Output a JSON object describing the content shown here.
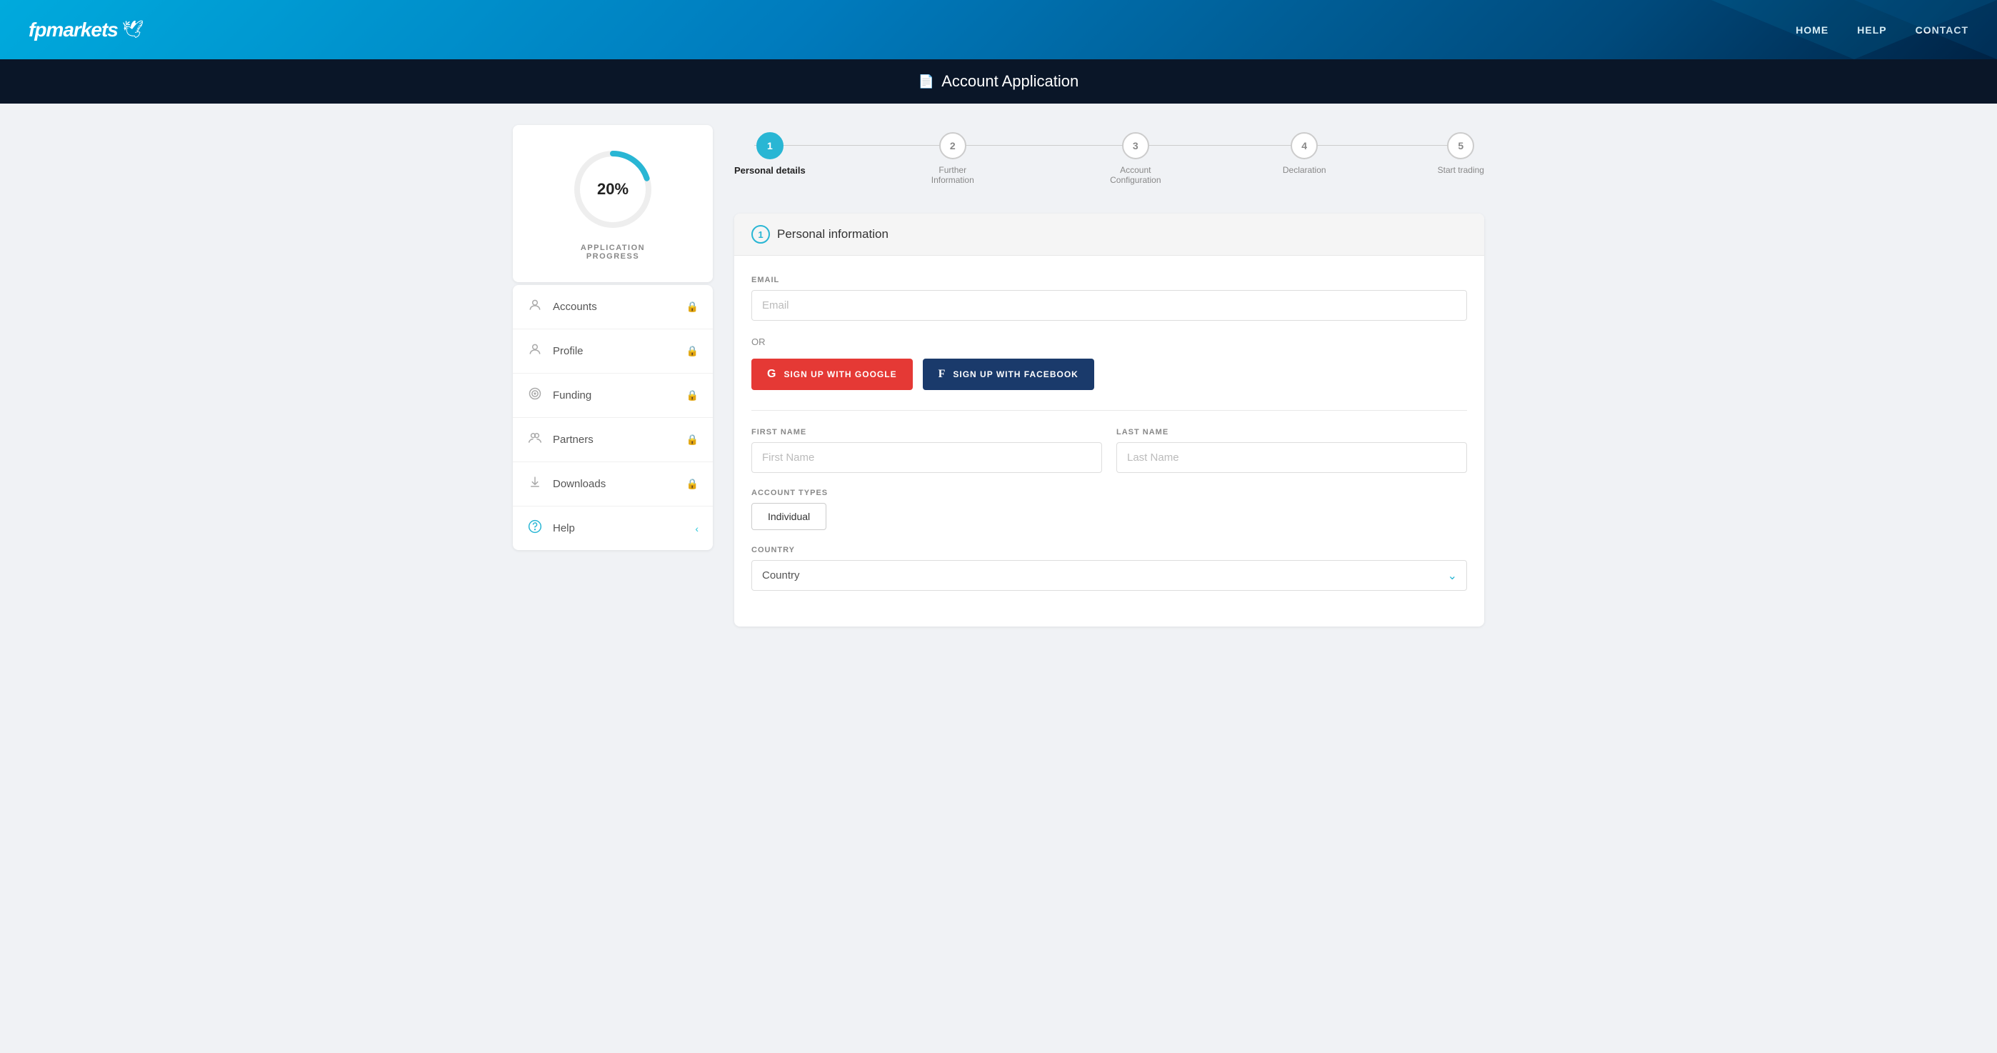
{
  "header": {
    "logo_text": "fpmarkets",
    "nav": [
      {
        "label": "HOME",
        "id": "home"
      },
      {
        "label": "HELP",
        "id": "help"
      },
      {
        "label": "CONTACT",
        "id": "contact"
      }
    ]
  },
  "page_title_bar": {
    "icon": "📄",
    "title": "Account Application"
  },
  "sidebar": {
    "progress_percent": "20%",
    "progress_label_line1": "APPLICATION",
    "progress_label_line2": "PROGRESS",
    "nav_items": [
      {
        "id": "accounts",
        "icon": "👤",
        "label": "Accounts",
        "right": "lock"
      },
      {
        "id": "profile",
        "icon": "👤",
        "label": "Profile",
        "right": "lock"
      },
      {
        "id": "funding",
        "icon": "💳",
        "label": "Funding",
        "right": "lock"
      },
      {
        "id": "partners",
        "icon": "👥",
        "label": "Partners",
        "right": "lock"
      },
      {
        "id": "downloads",
        "icon": "⬇",
        "label": "Downloads",
        "right": "lock"
      },
      {
        "id": "help",
        "icon": "❓",
        "label": "Help",
        "right": "chevron"
      }
    ]
  },
  "steps": [
    {
      "number": "1",
      "label": "Personal details",
      "active": true
    },
    {
      "number": "2",
      "label": "Further Information",
      "active": false
    },
    {
      "number": "3",
      "label": "Account Configuration",
      "active": false
    },
    {
      "number": "4",
      "label": "Declaration",
      "active": false
    },
    {
      "number": "5",
      "label": "Start trading",
      "active": false
    }
  ],
  "form": {
    "section_number": "1",
    "section_title": "Personal information",
    "email_label": "EMAIL",
    "email_placeholder": "Email",
    "or_text": "OR",
    "google_btn": "SIGN UP WITH GOOGLE",
    "facebook_btn": "SIGN UP WITH FACEBOOK",
    "first_name_label": "FIRST NAME",
    "first_name_placeholder": "First Name",
    "last_name_label": "LAST NAME",
    "last_name_placeholder": "Last Name",
    "account_types_label": "ACCOUNT TYPES",
    "account_type_value": "Individual",
    "country_label": "COUNTRY",
    "country_placeholder": "Country"
  },
  "colors": {
    "accent": "#29b6d4",
    "google_red": "#e53935",
    "facebook_blue": "#1a3a6b"
  }
}
